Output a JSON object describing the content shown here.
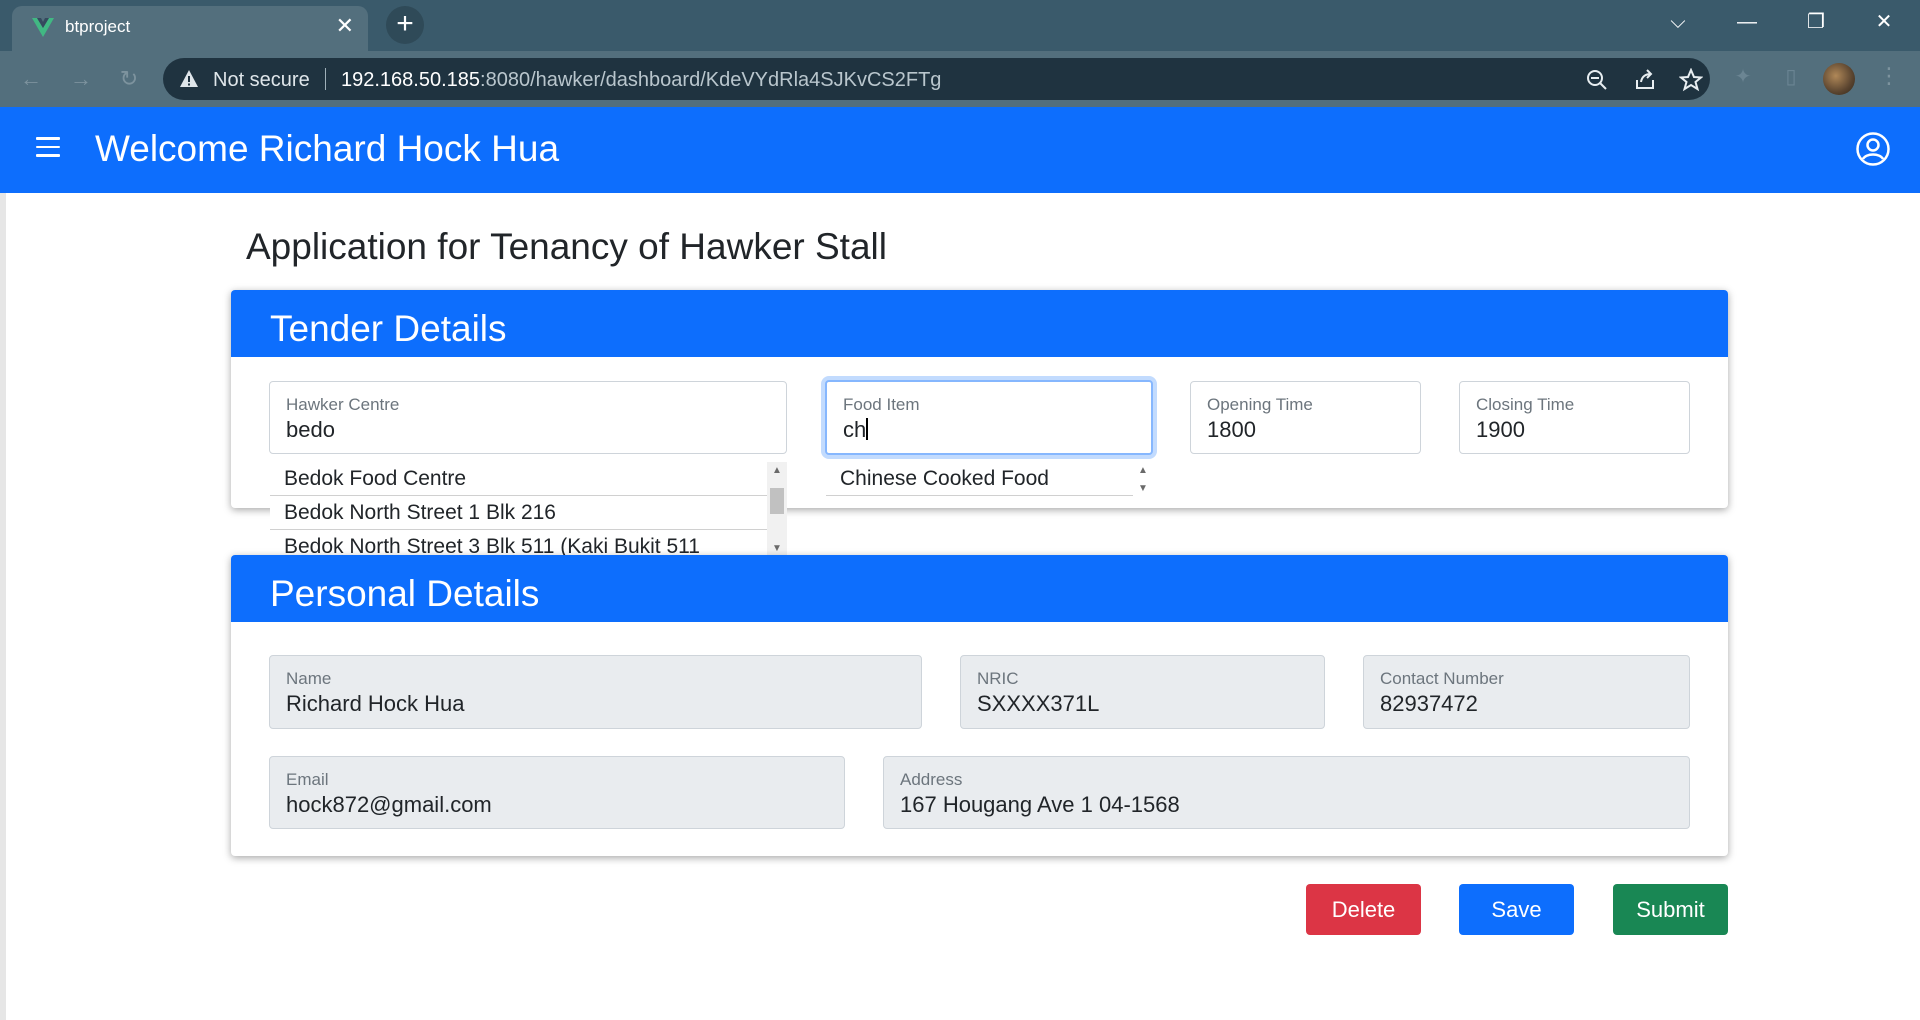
{
  "browser": {
    "tab_title": "btproject",
    "tab_close": "✕",
    "new_tab": "+",
    "security_text": "Not secure",
    "url_host": "192.168.50.185",
    "url_rest": ":8080/hawker/dashboard/KdeVYdRla4SJKvCS2FTg",
    "window_controls": [
      "chevron-down",
      "minimize",
      "restore",
      "close"
    ]
  },
  "header": {
    "welcome": "Welcome Richard Hock Hua"
  },
  "page": {
    "title": "Application for Tenancy of Hawker Stall"
  },
  "tender": {
    "heading": "Tender Details",
    "hawker_centre": {
      "label": "Hawker Centre",
      "value": "bedo"
    },
    "hawker_suggestions": [
      "Bedok Food Centre",
      "Bedok North Street 1 Blk 216",
      "Bedok North Street 3 Blk 511 (Kaki Bukit 511"
    ],
    "food_item": {
      "label": "Food Item",
      "value": "ch"
    },
    "food_suggestions": [
      "Chinese Cooked Food"
    ],
    "opening_time": {
      "label": "Opening Time",
      "value": "1800"
    },
    "closing_time": {
      "label": "Closing Time",
      "value": "1900"
    }
  },
  "personal": {
    "heading": "Personal Details",
    "name": {
      "label": "Name",
      "value": "Richard Hock Hua"
    },
    "nric": {
      "label": "NRIC",
      "value": "SXXXX371L"
    },
    "contact": {
      "label": "Contact Number",
      "value": "82937472"
    },
    "email": {
      "label": "Email",
      "value": "hock872@gmail.com"
    },
    "address": {
      "label": "Address",
      "value": "167 Hougang Ave 1 04-1568"
    }
  },
  "actions": {
    "delete": "Delete",
    "save": "Save",
    "submit": "Submit"
  },
  "colors": {
    "primary": "#0d6efd",
    "danger": "#dc3545",
    "success": "#198754",
    "browser_frame": "#3a5a6b"
  }
}
